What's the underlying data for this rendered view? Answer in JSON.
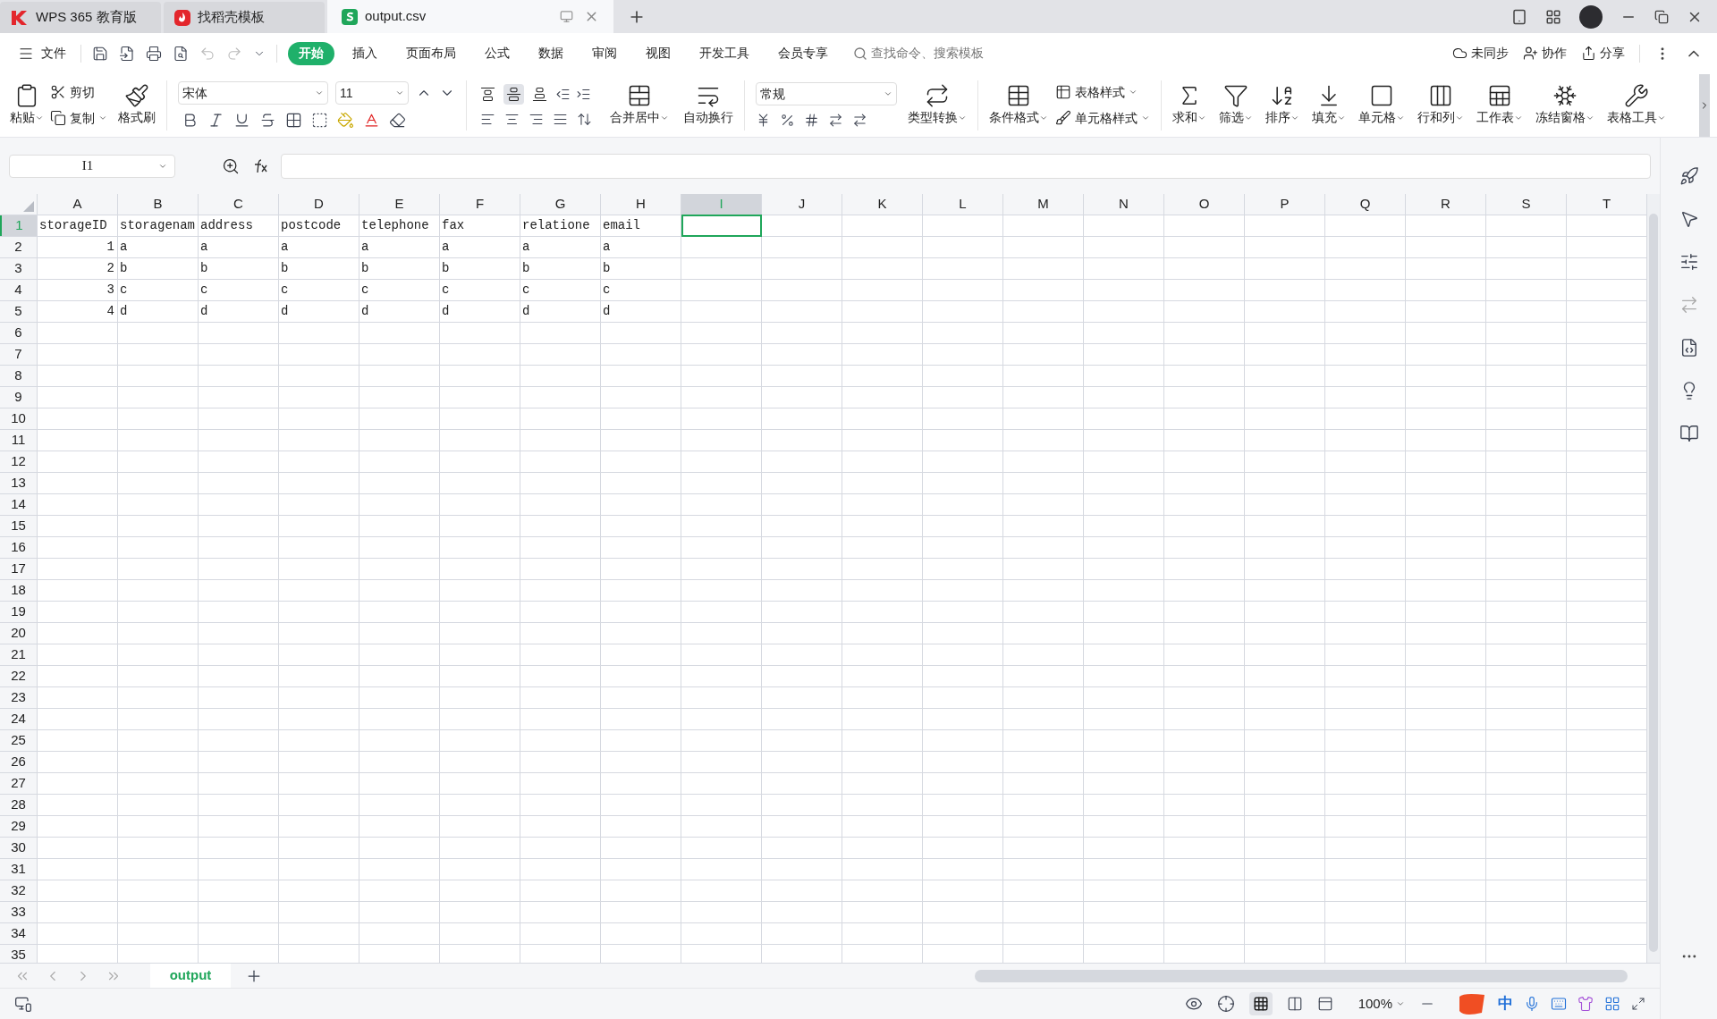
{
  "window_tabs": [
    {
      "label": "WPS 365 教育版",
      "kind": "home",
      "selected": false
    },
    {
      "label": "找稻壳模板",
      "kind": "docer",
      "selected": false
    },
    {
      "label": "output.csv",
      "kind": "sheet",
      "selected": true
    }
  ],
  "menu": {
    "file": "文件",
    "tabs": [
      {
        "label": "开始",
        "selected": true
      },
      {
        "label": "插入",
        "selected": false
      },
      {
        "label": "页面布局",
        "selected": false
      },
      {
        "label": "公式",
        "selected": false
      },
      {
        "label": "数据",
        "selected": false
      },
      {
        "label": "审阅",
        "selected": false
      },
      {
        "label": "视图",
        "selected": false
      },
      {
        "label": "开发工具",
        "selected": false
      },
      {
        "label": "会员专享",
        "selected": false
      }
    ],
    "search": {
      "placeholder": "查找命令、搜索模板"
    },
    "actions": [
      {
        "label": "未同步",
        "kind": "sync"
      },
      {
        "label": "协作",
        "kind": "collab"
      },
      {
        "label": "分享",
        "kind": "share"
      }
    ]
  },
  "ribbon": {
    "paste": "粘贴",
    "cut": "剪切",
    "copy": "复制",
    "format_painter": "格式刷",
    "font_name": "宋体",
    "font_size": "11",
    "vertical_align": [
      {
        "kind": "top",
        "selected": false
      },
      {
        "kind": "middle",
        "selected": true
      },
      {
        "kind": "bottom",
        "selected": false
      }
    ],
    "merge": "合并居中",
    "wrap": "自动换行",
    "number_format": "常规",
    "convert": "类型转换",
    "conditional_format": "条件格式",
    "table_style": "表格样式",
    "cell_style": "单元格样式",
    "big_buttons": [
      {
        "label": "求和",
        "kind": "sum"
      },
      {
        "label": "筛选",
        "kind": "filter"
      },
      {
        "label": "排序",
        "kind": "sort"
      },
      {
        "label": "填充",
        "kind": "fill"
      },
      {
        "label": "单元格",
        "kind": "cell"
      },
      {
        "label": "行和列",
        "kind": "rows"
      },
      {
        "label": "工作表",
        "kind": "sheet"
      },
      {
        "label": "冻结窗格",
        "kind": "freeze"
      },
      {
        "label": "表格工具",
        "kind": "tools"
      }
    ]
  },
  "formula_bar": {
    "name_box": "I1"
  },
  "grid": {
    "columns": [
      {
        "label": "A",
        "selected": false
      },
      {
        "label": "B",
        "selected": false
      },
      {
        "label": "C",
        "selected": false
      },
      {
        "label": "D",
        "selected": false
      },
      {
        "label": "E",
        "selected": false
      },
      {
        "label": "F",
        "selected": false
      },
      {
        "label": "G",
        "selected": false
      },
      {
        "label": "H",
        "selected": false
      },
      {
        "label": "I",
        "selected": true
      },
      {
        "label": "J",
        "selected": false
      },
      {
        "label": "K",
        "selected": false
      },
      {
        "label": "L",
        "selected": false
      },
      {
        "label": "M",
        "selected": false
      },
      {
        "label": "N",
        "selected": false
      },
      {
        "label": "O",
        "selected": false
      },
      {
        "label": "P",
        "selected": false
      },
      {
        "label": "Q",
        "selected": false
      },
      {
        "label": "R",
        "selected": false
      },
      {
        "label": "S",
        "selected": false
      },
      {
        "label": "T",
        "selected": false
      }
    ],
    "rows": [
      {
        "number": "1",
        "selected": true,
        "cells": [
          {
            "text": "storageID",
            "kind": "text"
          },
          {
            "text": "storagenam",
            "kind": "text"
          },
          {
            "text": "address",
            "kind": "text"
          },
          {
            "text": "postcode",
            "kind": "text"
          },
          {
            "text": "telephone",
            "kind": "text"
          },
          {
            "text": "fax",
            "kind": "text"
          },
          {
            "text": "relatione",
            "kind": "text"
          },
          {
            "text": "email",
            "kind": "text"
          }
        ]
      },
      {
        "number": "2",
        "selected": false,
        "cells": [
          {
            "text": "1",
            "kind": "number"
          },
          {
            "text": "a",
            "kind": "text"
          },
          {
            "text": "a",
            "kind": "text"
          },
          {
            "text": "a",
            "kind": "text"
          },
          {
            "text": "a",
            "kind": "text"
          },
          {
            "text": "a",
            "kind": "text"
          },
          {
            "text": "a",
            "kind": "text"
          },
          {
            "text": "a",
            "kind": "text"
          }
        ]
      },
      {
        "number": "3",
        "selected": false,
        "cells": [
          {
            "text": "2",
            "kind": "number"
          },
          {
            "text": "b",
            "kind": "text"
          },
          {
            "text": "b",
            "kind": "text"
          },
          {
            "text": "b",
            "kind": "text"
          },
          {
            "text": "b",
            "kind": "text"
          },
          {
            "text": "b",
            "kind": "text"
          },
          {
            "text": "b",
            "kind": "text"
          },
          {
            "text": "b",
            "kind": "text"
          }
        ]
      },
      {
        "number": "4",
        "selected": false,
        "cells": [
          {
            "text": "3",
            "kind": "number"
          },
          {
            "text": "c",
            "kind": "text"
          },
          {
            "text": "c",
            "kind": "text"
          },
          {
            "text": "c",
            "kind": "text"
          },
          {
            "text": "c",
            "kind": "text"
          },
          {
            "text": "c",
            "kind": "text"
          },
          {
            "text": "c",
            "kind": "text"
          },
          {
            "text": "c",
            "kind": "text"
          }
        ]
      },
      {
        "number": "5",
        "selected": false,
        "cells": [
          {
            "text": "4",
            "kind": "number"
          },
          {
            "text": "d",
            "kind": "text"
          },
          {
            "text": "d",
            "kind": "text"
          },
          {
            "text": "d",
            "kind": "text"
          },
          {
            "text": "d",
            "kind": "text"
          },
          {
            "text": "d",
            "kind": "text"
          },
          {
            "text": "d",
            "kind": "text"
          },
          {
            "text": "d",
            "kind": "text"
          }
        ]
      },
      {
        "number": "6",
        "selected": false
      },
      {
        "number": "7",
        "selected": false
      },
      {
        "number": "8",
        "selected": false
      },
      {
        "number": "9",
        "selected": false
      },
      {
        "number": "10",
        "selected": false
      },
      {
        "number": "11",
        "selected": false
      },
      {
        "number": "12",
        "selected": false
      },
      {
        "number": "13",
        "selected": false
      },
      {
        "number": "14",
        "selected": false
      },
      {
        "number": "15",
        "selected": false
      },
      {
        "number": "16",
        "selected": false
      },
      {
        "number": "17",
        "selected": false
      },
      {
        "number": "18",
        "selected": false
      },
      {
        "number": "19",
        "selected": false
      },
      {
        "number": "20",
        "selected": false
      },
      {
        "number": "21",
        "selected": false
      },
      {
        "number": "22",
        "selected": false
      },
      {
        "number": "23",
        "selected": false
      },
      {
        "number": "24",
        "selected": false
      },
      {
        "number": "25",
        "selected": false
      },
      {
        "number": "26",
        "selected": false
      },
      {
        "number": "27",
        "selected": false
      },
      {
        "number": "28",
        "selected": false
      },
      {
        "number": "29",
        "selected": false
      },
      {
        "number": "30",
        "selected": false
      },
      {
        "number": "31",
        "selected": false
      },
      {
        "number": "32",
        "selected": false
      },
      {
        "number": "33",
        "selected": false
      },
      {
        "number": "34",
        "selected": false
      },
      {
        "number": "35",
        "selected": false
      }
    ]
  },
  "sheet_tabs": [
    {
      "label": "output",
      "selected": true
    }
  ],
  "status_bar": {
    "zoom": "100%",
    "ime_mode": "中"
  }
}
